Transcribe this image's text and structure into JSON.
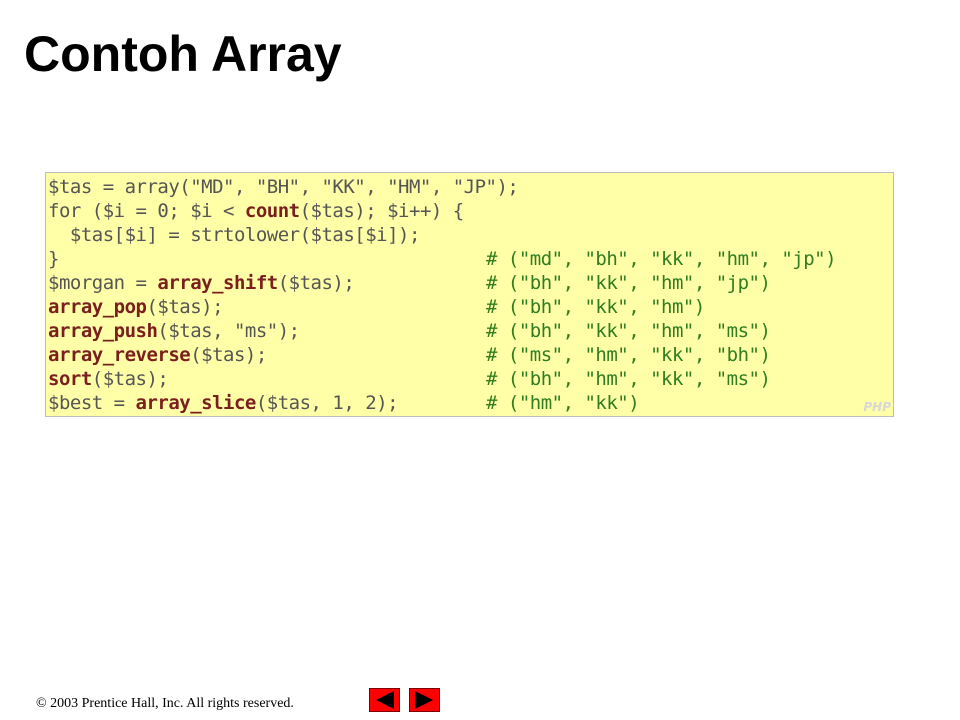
{
  "title": "Contoh Array",
  "code": {
    "lines": [
      {
        "c": "$tas = array(\"MD\", \"BH\", \"KK\", \"HM\", \"JP\");",
        "comment": ""
      },
      {
        "a": "for ($i = 0; $i < ",
        "kw": "count",
        "b": "($tas); $i++) {",
        "comment": ""
      },
      {
        "c": "  $tas[$i] = strtolower($tas[$i]);",
        "comment": ""
      },
      {
        "c": "}",
        "comment": "# (\"md\", \"bh\", \"kk\", \"hm\", \"jp\")"
      },
      {
        "a": "$morgan = ",
        "kw": "array_shift",
        "b": "($tas);",
        "comment": "# (\"bh\", \"kk\", \"hm\", \"jp\")"
      },
      {
        "a": "",
        "kw": "array_pop",
        "b": "($tas);",
        "comment": "# (\"bh\", \"kk\", \"hm\")"
      },
      {
        "a": "",
        "kw": "array_push",
        "b": "($tas, \"ms\");",
        "comment": "# (\"bh\", \"kk\", \"hm\", \"ms\")"
      },
      {
        "a": "",
        "kw": "array_reverse",
        "b": "($tas);",
        "comment": "# (\"ms\", \"hm\", \"kk\", \"bh\")"
      },
      {
        "a": "",
        "kw": "sort",
        "b": "($tas);",
        "comment": "# (\"bh\", \"hm\", \"kk\", \"ms\")"
      },
      {
        "a": "$best = ",
        "kw": "array_slice",
        "b": "($tas, 1, 2);",
        "comment": "# (\"hm\", \"kk\")"
      }
    ],
    "language_tag": "PHP"
  },
  "footer": {
    "copyright": "© 2003 Prentice Hall, Inc.  All rights reserved."
  },
  "nav": {
    "prev_icon": "left-triangle-icon",
    "next_icon": "right-triangle-icon",
    "color": "#ff0000"
  }
}
